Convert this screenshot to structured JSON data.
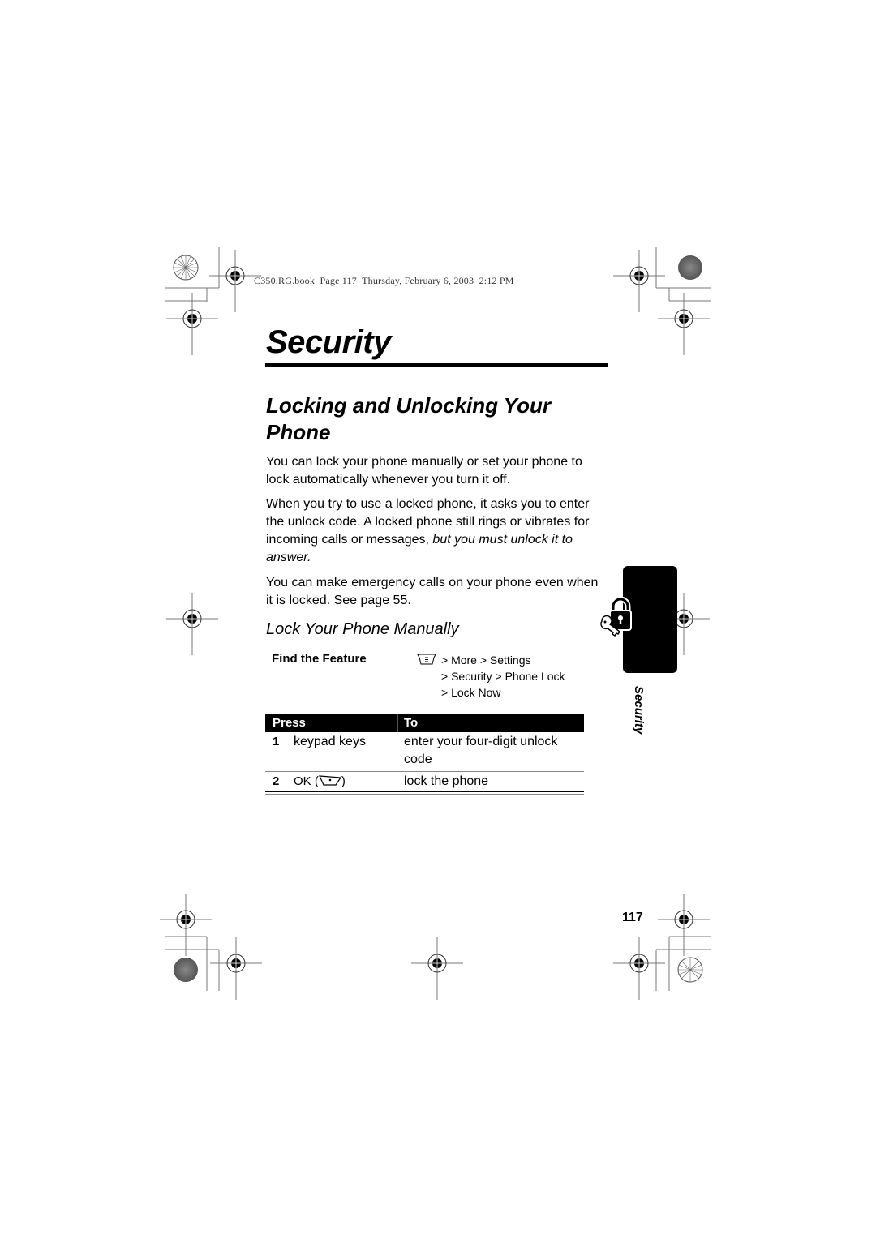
{
  "print_header": {
    "text": "C350.RG.book  Page 117  Thursday, February 6, 2003  2:12 PM"
  },
  "chapter": {
    "title": "Security"
  },
  "section": {
    "title": "Locking and Unlocking Your Phone",
    "paragraphs": [
      {
        "text": "You can lock your phone manually or set your phone to lock automatically whenever you turn it off."
      },
      {
        "text": "When you try to use a locked phone, it asks you to enter the unlock code. A locked phone still rings or vibrates for incoming calls or messages, ",
        "italic_tail": "but you must unlock it to answer."
      },
      {
        "text": "You can make emergency calls on your phone even when it is locked. See page 55."
      }
    ]
  },
  "subsection": {
    "title": "Lock Your Phone Manually",
    "find_feature": {
      "label": "Find the Feature",
      "menu_icon": "menu-key-icon",
      "path_lines": [
        "> More > Settings",
        "> Security > Phone Lock",
        "> Lock Now"
      ]
    },
    "table": {
      "headers": [
        "Press",
        "To"
      ],
      "rows": [
        {
          "num": "1",
          "press": "keypad keys",
          "to": "enter your four-digit unlock code"
        },
        {
          "num": "2",
          "press": "OK (",
          "press_icon": "softkey-icon",
          "press_tail": ")",
          "to": "lock the phone"
        }
      ]
    }
  },
  "side_tab": {
    "label": "Security",
    "icon": "lock-and-key-icon"
  },
  "page_number": "117"
}
